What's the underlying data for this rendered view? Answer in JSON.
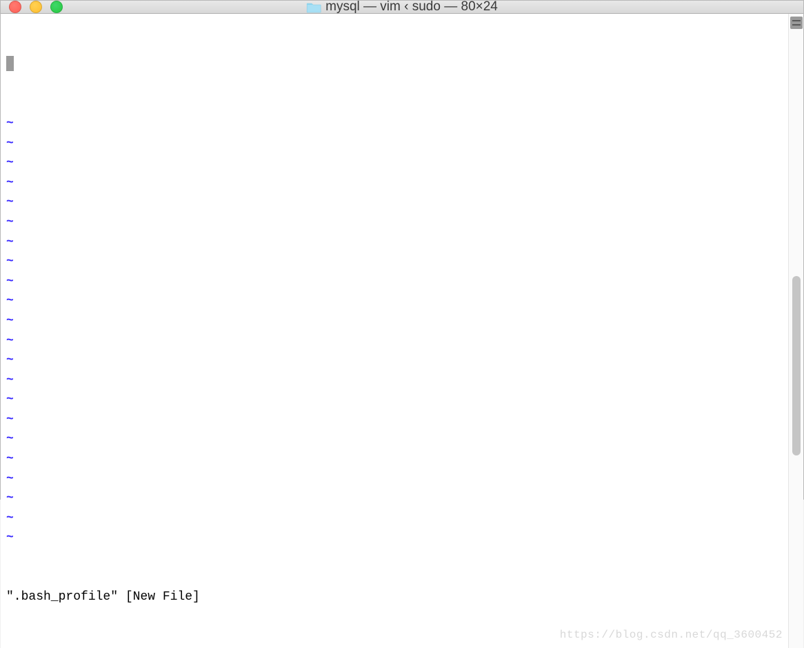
{
  "window": {
    "title": "mysql — vim ‹ sudo — 80×24"
  },
  "editor": {
    "tilde_char": "~",
    "empty_line_count": 22,
    "status_line": "\".bash_profile\" [New File]"
  },
  "watermark": "https://blog.csdn.net/qq_3600452"
}
